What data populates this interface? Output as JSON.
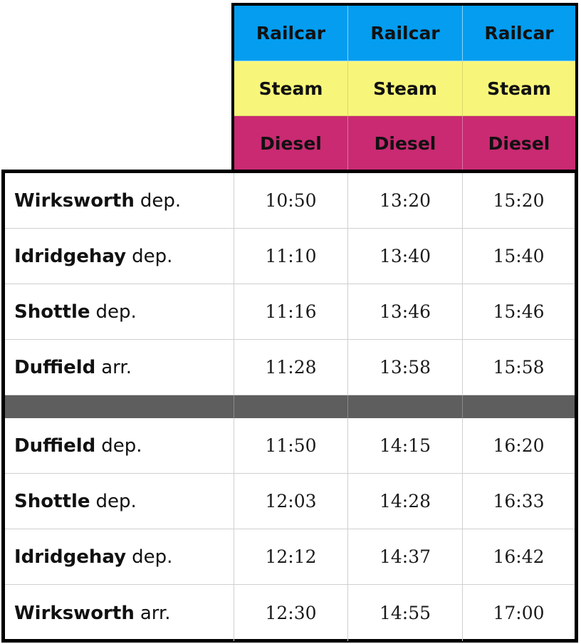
{
  "header": {
    "columns": [
      {
        "row1": "Railcar",
        "row2": "Steam",
        "row3": "Diesel"
      },
      {
        "row1": "Railcar",
        "row2": "Steam",
        "row3": "Diesel"
      },
      {
        "row1": "Railcar",
        "row2": "Steam",
        "row3": "Diesel"
      }
    ],
    "colors": {
      "railcar": "#049df0",
      "steam": "#f8f67a",
      "diesel": "#c92a72",
      "divider": "#5e5e5e"
    }
  },
  "outbound": [
    {
      "station": "Wirksworth",
      "type": "dep.",
      "times": [
        "10:50",
        "13:20",
        "15:20"
      ]
    },
    {
      "station": "Idridgehay",
      "type": "dep.",
      "times": [
        "11:10",
        "13:40",
        "15:40"
      ]
    },
    {
      "station": "Shottle",
      "type": "dep.",
      "times": [
        "11:16",
        "13:46",
        "15:46"
      ]
    },
    {
      "station": "Duffield",
      "type": "arr.",
      "times": [
        "11:28",
        "13:58",
        "15:58"
      ]
    }
  ],
  "return": [
    {
      "station": "Duffield",
      "type": "dep.",
      "times": [
        "11:50",
        "14:15",
        "16:20"
      ]
    },
    {
      "station": "Shottle",
      "type": "dep.",
      "times": [
        "12:03",
        "14:28",
        "16:33"
      ]
    },
    {
      "station": "Idridgehay",
      "type": "dep.",
      "times": [
        "12:12",
        "14:37",
        "16:42"
      ]
    },
    {
      "station": "Wirksworth",
      "type": "arr.",
      "times": [
        "12:30",
        "14:55",
        "17:00"
      ]
    }
  ]
}
